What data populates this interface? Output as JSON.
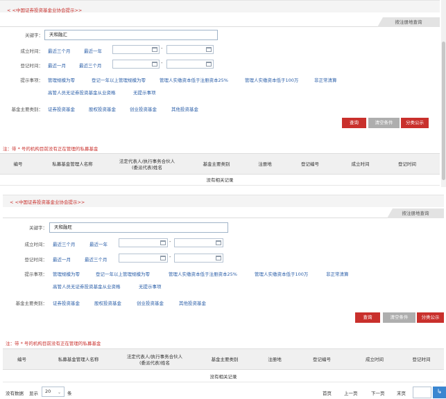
{
  "panels": [
    {
      "breadcrumb": "< <中国证券投资基金业协会提示>>",
      "search_tab": "按注册地查询",
      "keyword_label": "关键字：",
      "keyword_value": "天和融汇",
      "established_label": "成立时间：",
      "established_links": [
        "最近三个月",
        "最近一年"
      ],
      "registered_label": "登记时间：",
      "registered_links": [
        "最近一月",
        "最近三个月"
      ],
      "date_dash": "-",
      "hint_label": "提示事项：",
      "hints_row1": [
        "管理规模为零",
        "登记一年以上管理规模为零",
        "管理人实缴资本低于注册资本25%",
        "管理人实缴资本低于100万",
        "非正常清算"
      ],
      "hints_row2": [
        "高管人员无证券投资基金从业资格",
        "无提示事项"
      ],
      "fund_type_label": "基金主要类别：",
      "fund_types": [
        "证券投资基金",
        "股权投资基金",
        "创业投资基金",
        "其他投资基金"
      ],
      "buttons": {
        "query": "查询",
        "clear": "清空条件",
        "classify": "分类公示"
      },
      "note": "注：带 * 号的机构目前没有正在管理的私募基金",
      "columns": [
        "编号",
        "私募基金管理人名称",
        "法定代表人/执行事务合伙人\n(委派代表)姓名",
        "基金主要类别",
        "注册地",
        "登记编号",
        "成立时间",
        "登记时间"
      ],
      "empty_text": "没有相关记录"
    },
    {
      "breadcrumb": "< <中国证券投资基金业协会提示>>",
      "search_tab": "按注册地查询",
      "keyword_label": "关键字：",
      "keyword_value": "天和融旺",
      "established_label": "成立时间：",
      "established_links": [
        "最近三个月",
        "最近一年"
      ],
      "registered_label": "登记时间：",
      "registered_links": [
        "最近一月",
        "最近三个月"
      ],
      "date_dash": "-",
      "hint_label": "提示事项：",
      "hints_row1": [
        "管理规模为零",
        "登记一年以上管理规模为零",
        "管理人实缴资本低于注册资本25%",
        "管理人实缴资本低于100万",
        "非正常清算"
      ],
      "hints_row2": [
        "高管人员无证券投资基金从业资格",
        "无提示事项"
      ],
      "fund_type_label": "基金主要类别：",
      "fund_types": [
        "证券投资基金",
        "股权投资基金",
        "创业投资基金",
        "其他投资基金"
      ],
      "buttons": {
        "query": "查询",
        "clear": "清空条件",
        "classify": "分类公示"
      },
      "note": "注：带 * 号的机构目前没有正在管理的私募基金",
      "columns": [
        "编号",
        "私募基金管理人名称",
        "法定代表人/执行事务合伙人\n(委派代表)姓名",
        "基金主要类别",
        "注册地",
        "登记编号",
        "成立时间",
        "登记时间"
      ],
      "empty_text": "没有相关记录"
    }
  ],
  "pager": {
    "no_data": "没有数据",
    "show": "显示",
    "page_size": "20",
    "unit": "条",
    "first": "首页",
    "prev": "上一页",
    "next": "下一页",
    "last": "末页",
    "go_icon": "arrow-return-icon"
  },
  "colors": {
    "accent_red": "#c9302c",
    "link_blue": "#2a5ea8",
    "go_blue": "#3a86d0"
  }
}
